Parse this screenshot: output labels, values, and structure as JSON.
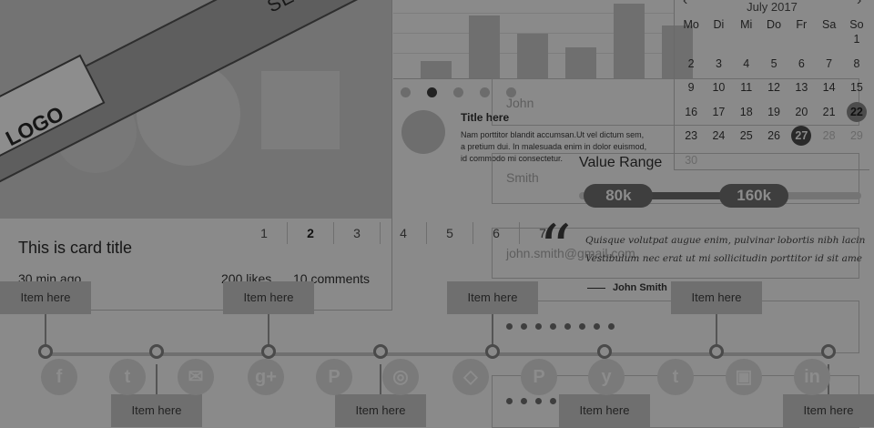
{
  "card": {
    "ribbon_label": "SELECTED",
    "logo_label": "LOGO",
    "title": "This is card title",
    "time": "30 min ago",
    "likes": "200 likes",
    "comments": "10 comments"
  },
  "pagination": {
    "pages": [
      "1",
      "2",
      "3",
      "4",
      "5",
      "6",
      "7"
    ],
    "active": "2"
  },
  "bar_chart": {
    "values": [
      22,
      80,
      57,
      40,
      95,
      68
    ]
  },
  "media": {
    "title": "Title here",
    "body_lines": [
      "Nam porttitor blandit accumsan.Ut vel dictum sem,",
      "a pretium dui. In malesuada enim in dolor euismod,",
      "id commodo mi consectetur."
    ]
  },
  "form": {
    "first_name": "John",
    "last_name": "Smith",
    "email": "john.smith@gmail.com"
  },
  "range": {
    "title": "Value Range",
    "min_label": "80k",
    "max_label": "160k",
    "min_fraction": 0.14,
    "max_fraction": 0.62
  },
  "quote": {
    "mark": "“",
    "line1": "Quisque volutpat augue enim, pulvinar lobortis nibh lacin",
    "line2": "Vestibulum nec erat ut mi sollicitudin porttitor id sit ame",
    "author": "John Smith"
  },
  "calendar": {
    "month": "July 2017",
    "prev_icon": "‹",
    "next_icon": "›",
    "weekdays": [
      "Mo",
      "Di",
      "Mi",
      "Do",
      "Fr",
      "Sa",
      "So"
    ],
    "rows": [
      [
        "",
        "",
        "",
        "",
        "",
        "",
        "1"
      ],
      [
        "2",
        "3",
        "4",
        "5",
        "6",
        "7",
        "8"
      ],
      [
        "9",
        "10",
        "11",
        "12",
        "13",
        "14",
        "15"
      ],
      [
        "16",
        "17",
        "18",
        "19",
        "20",
        "21",
        "22"
      ],
      [
        "23",
        "24",
        "25",
        "26",
        "27",
        "28",
        "29"
      ],
      [
        "30",
        "",
        "",
        "",
        "",
        "",
        ""
      ]
    ],
    "highlighted": "22",
    "today": "27"
  },
  "timeline": {
    "item_label": "Item here"
  },
  "social_icons": [
    "facebook-icon",
    "twitter-icon",
    "mail-icon",
    "google-plus-icon",
    "pinterest-icon",
    "dribbble-icon",
    "dropbox-icon",
    "pinterest-icon",
    "yelp-icon",
    "tumblr-icon",
    "instagram-icon",
    "linkedin-icon"
  ],
  "colors": {
    "background": "#8a8a8a",
    "dark": "#2a2a2a"
  }
}
